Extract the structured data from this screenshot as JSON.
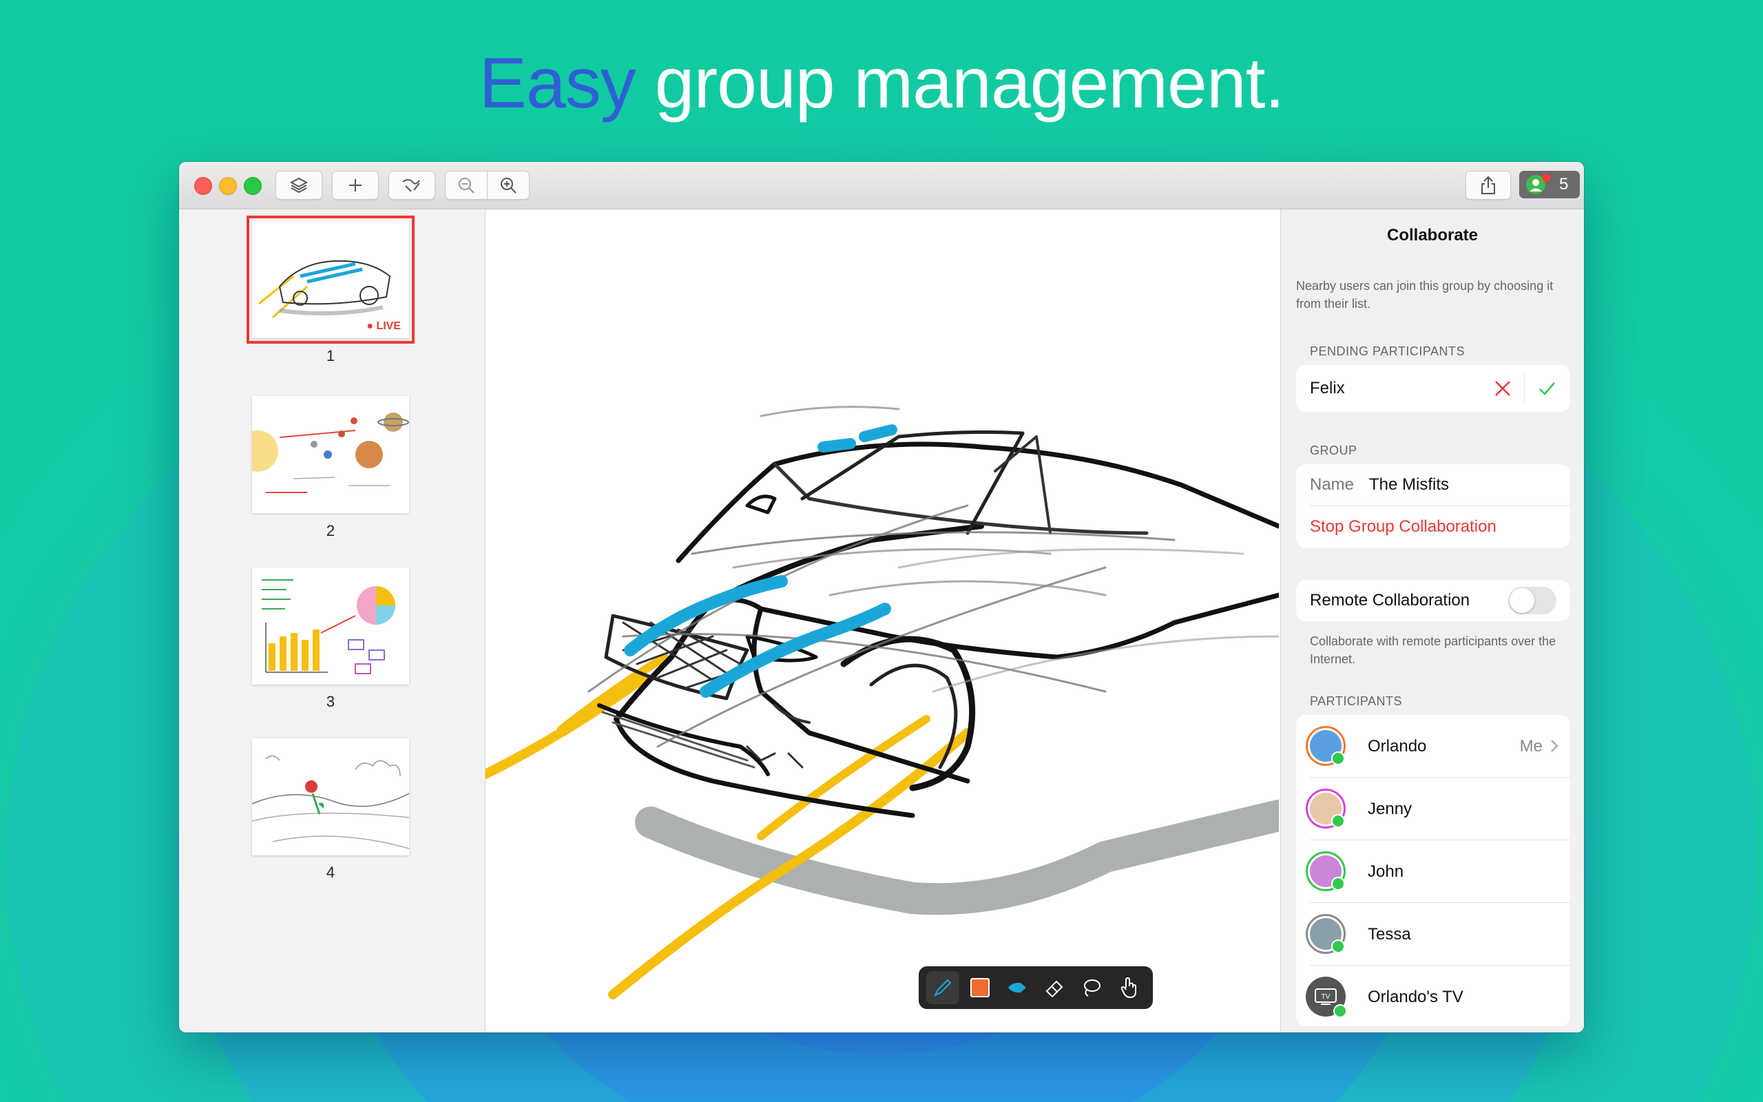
{
  "headline": {
    "accent": "Easy",
    "rest": "group management."
  },
  "titlebar": {
    "participant_count": "5"
  },
  "sidebar": {
    "pages": [
      {
        "number": "1",
        "live": "LIVE"
      },
      {
        "number": "2"
      },
      {
        "number": "3"
      },
      {
        "number": "4"
      }
    ]
  },
  "toolbar": {
    "tools": [
      "pen-icon",
      "color-swatch",
      "marker-icon",
      "eraser-icon",
      "lasso-icon",
      "hand-icon"
    ],
    "swatch_color": "#f26b2e",
    "marker_color": "#1aa7d8"
  },
  "panel": {
    "title": "Collaborate",
    "description": "Nearby users can join this group by choosing it from their list.",
    "pending_label": "PENDING PARTICIPANTS",
    "pending_name": "Felix",
    "group_label": "GROUP",
    "name_label": "Name",
    "name_value": "The Misfits",
    "stop_label": "Stop Group Collaboration",
    "remote_label": "Remote Collaboration",
    "remote_desc": "Collaborate with remote participants over the Internet.",
    "participants_label": "PARTICIPANTS",
    "participants": [
      {
        "name": "Orlando",
        "tag": "Me",
        "ring": "#f27a2a"
      },
      {
        "name": "Jenny",
        "ring": "#d347d6"
      },
      {
        "name": "John",
        "ring": "#39c44f"
      },
      {
        "name": "Tessa",
        "ring": "#8a8a8a"
      },
      {
        "name": "Orlando's TV",
        "ring": "#555555"
      }
    ]
  },
  "colors": {
    "accent_red": "#ec3a36",
    "online": "#31c94f",
    "stripe_blue": "#1aa7d8",
    "road_yellow": "#f5bf0f"
  }
}
